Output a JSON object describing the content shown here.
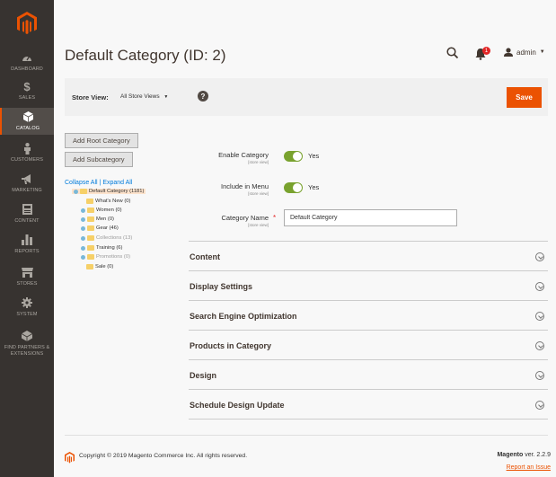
{
  "sidebar": {
    "items": [
      {
        "label": "DASHBOARD"
      },
      {
        "label": "SALES"
      },
      {
        "label": "CATALOG"
      },
      {
        "label": "CUSTOMERS"
      },
      {
        "label": "MARKETING"
      },
      {
        "label": "CONTENT"
      },
      {
        "label": "REPORTS"
      },
      {
        "label": "STORES"
      },
      {
        "label": "SYSTEM"
      },
      {
        "label": "FIND PARTNERS & EXTENSIONS"
      }
    ],
    "active_index": 2
  },
  "header": {
    "title": "Default Category (ID: 2)",
    "notification_count": "1",
    "user": "admin"
  },
  "toolbar": {
    "store_view_label": "Store View:",
    "store_view_value": "All Store Views",
    "help": "?",
    "save_label": "Save"
  },
  "tree": {
    "add_root_label": "Add Root Category",
    "add_sub_label": "Add Subcategory",
    "collapse_all": "Collapse All",
    "separator": "|",
    "expand_all": "Expand All",
    "nodes": [
      {
        "label": "Default Category (1181)"
      },
      {
        "label": "What's New (0)"
      },
      {
        "label": "Women (0)"
      },
      {
        "label": "Men (0)"
      },
      {
        "label": "Gear (46)"
      },
      {
        "label": "Collections (13)"
      },
      {
        "label": "Training (6)"
      },
      {
        "label": "Promotions (0)"
      },
      {
        "label": "Sale (0)"
      }
    ]
  },
  "form": {
    "enable_label": "Enable Category",
    "enable_scope": "[store view]",
    "enable_value": "Yes",
    "menu_label": "Include in Menu",
    "menu_scope": "[store view]",
    "menu_value": "Yes",
    "name_label": "Category Name",
    "name_scope": "[store view]",
    "name_value": "Default Category"
  },
  "sections": [
    {
      "title": "Content"
    },
    {
      "title": "Display Settings"
    },
    {
      "title": "Search Engine Optimization"
    },
    {
      "title": "Products in Category"
    },
    {
      "title": "Design"
    },
    {
      "title": "Schedule Design Update"
    }
  ],
  "footer": {
    "copyright": "Copyright © 2019 Magento Commerce Inc. All rights reserved.",
    "brand": "Magento",
    "version": "ver. 2.2.9",
    "report_issue": "Report an Issue"
  },
  "colors": {
    "accent": "#eb5202",
    "sidebar_bg": "#373330",
    "toggle_on": "#79a22e",
    "link": "#007bdb"
  }
}
